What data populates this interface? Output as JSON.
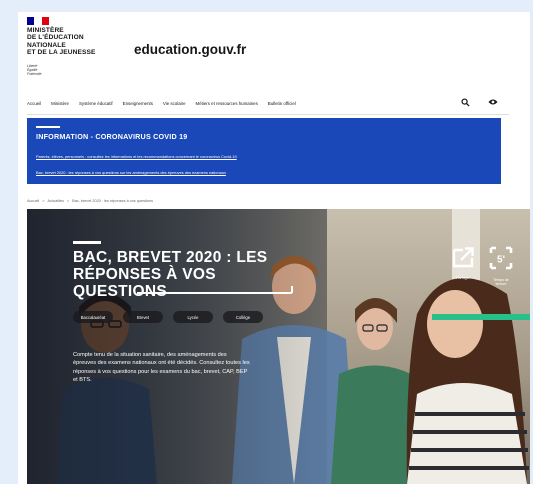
{
  "header": {
    "ministry_lines": [
      "MINISTÈRE",
      "DE L'ÉDUCATION",
      "NATIONALE",
      "ET DE LA JEUNESSE"
    ],
    "motto_lines": [
      "Liberté",
      "Égalité",
      "Fraternité"
    ],
    "site_title": "education.gouv.fr"
  },
  "nav": {
    "items": [
      "Accueil",
      "Ministère",
      "Système éducatif",
      "Enseignements",
      "Vie scolaire",
      "Métiers et ressources humaines",
      "Bulletin officiel"
    ],
    "icons": [
      "search-icon",
      "eye-icon"
    ]
  },
  "info_banner": {
    "title": "INFORMATION - CORONAVIRUS COVID 19",
    "links": [
      "Parents, élèves, personnels : consultez les informations et les recommandations concernant le coronavirus Covid-19",
      "Bac, brevet 2020 : les réponses à vos questions sur les aménagements des épreuves des examens nationaux"
    ],
    "color": "#1a48b8"
  },
  "breadcrumb": [
    "Accueil",
    ">",
    "Actualités",
    ">",
    "Bac, brevet 2020 : les réponses à vos questions"
  ],
  "hero": {
    "title_line1": "BAC, BREVET 2020 : LES",
    "title_line2": "RÉPONSES À VOS QUESTIONS",
    "tags": [
      "Baccalauréat",
      "Brevet",
      "Lycée",
      "Collège"
    ],
    "description": "Compte tenu de la situation sanitaire, des aménagements des épreuves des examens nationaux ont été décidés. Consultez toutes les réponses à vos questions pour les examens du bac, brevet, CAP, BEP et BTS.",
    "share_label": "Partager",
    "reading_time_value": "5'",
    "reading_time_label_line1": "Temps de",
    "reading_time_label_line2": "lecture",
    "accent_color": "#27c08a"
  }
}
